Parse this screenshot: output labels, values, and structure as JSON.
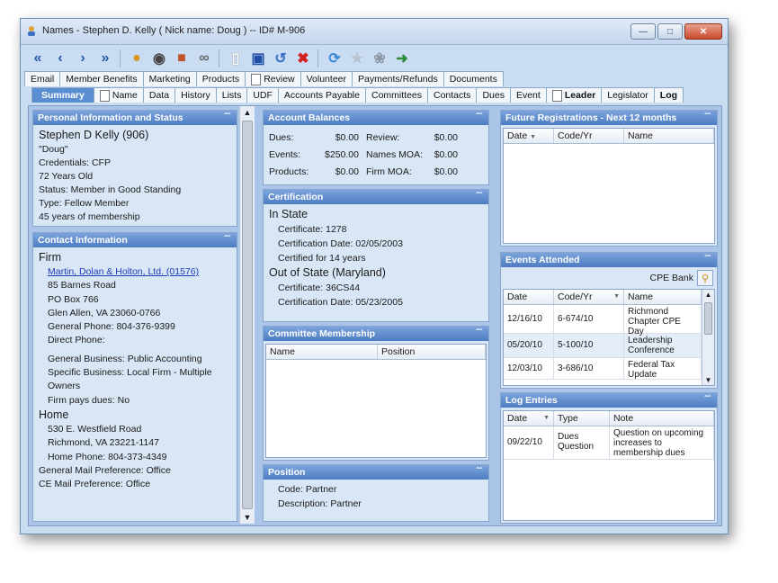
{
  "window": {
    "title": "Names - Stephen D. Kelly  ( Nick name: Doug )  -- ID# M-906"
  },
  "tabs_top": [
    "Email",
    "Member Benefits",
    "Marketing",
    "Products",
    "Review",
    "Volunteer",
    "Payments/Refunds",
    "Documents"
  ],
  "tabs_bottom": [
    "Summary",
    "Name",
    "Data",
    "History",
    "Lists",
    "UDF",
    "Accounts Payable",
    "Committees",
    "Contacts",
    "Dues",
    "Event",
    "Leader",
    "Legislator",
    "Log"
  ],
  "personal": {
    "header": "Personal Information and Status",
    "name": "Stephen D Kelly  (906)",
    "nick": "\"Doug\"",
    "credentials": "Credentials: CFP",
    "age": "72 Years Old",
    "status": "Status: Member in Good Standing",
    "type": "Type: Fellow Member",
    "years": "45 years of membership"
  },
  "contact": {
    "header": "Contact Information",
    "firm_label": "Firm",
    "firm_link": "Martin, Dolan & Holton, Ltd. (01576)",
    "addr1": "85 Barnes Road",
    "addr2": "PO Box 766",
    "city": "Glen Allen, VA 23060-0766",
    "gen_phone": "General Phone: 804-376-9399",
    "direct_phone": "Direct Phone:",
    "gen_business": "General Business: Public Accounting",
    "spec_business": "Specific Business: Local Firm - Multiple Owners",
    "firm_pays": "Firm pays dues: No",
    "home_label": "Home",
    "home_addr": "530 E. Westfield Road",
    "home_city": "Richmond, VA 23221-1147",
    "home_phone": "Home Phone: 804-373-4349",
    "gen_mail": "General Mail Preference: Office",
    "ce_mail": "CE Mail Preference: Office"
  },
  "balances": {
    "header": "Account Balances",
    "rows": [
      {
        "l1": "Dues:",
        "v1": "$0.00",
        "l2": "Review:",
        "v2": "$0.00"
      },
      {
        "l1": "Events:",
        "v1": "$250.00",
        "l2": "Names MOA:",
        "v2": "$0.00"
      },
      {
        "l1": "Products:",
        "v1": "$0.00",
        "l2": "Firm MOA:",
        "v2": "$0.00"
      }
    ]
  },
  "certification": {
    "header": "Certification",
    "in_state": "In State",
    "cert1": "Certificate: 1278",
    "cert1_date": "Certification Date: 02/05/2003",
    "cert1_for": "Certified for 14 years",
    "out_state": "Out of State (Maryland)",
    "cert2": "Certificate: 36CS44",
    "cert2_date": "Certification Date: 05/23/2005"
  },
  "committee": {
    "header": "Committee Membership",
    "col_name": "Name",
    "col_position": "Position"
  },
  "position": {
    "header": "Position",
    "code": "Code: Partner",
    "desc": "Description: Partner"
  },
  "future": {
    "header": "Future Registrations - Next 12 months",
    "col_date": "Date",
    "col_code": "Code/Yr",
    "col_name": "Name"
  },
  "events": {
    "header": "Events Attended",
    "cpe_bank": "CPE Bank",
    "col_date": "Date",
    "col_code": "Code/Yr",
    "col_name": "Name",
    "rows": [
      {
        "date": "12/16/10",
        "code": "6-674/10",
        "name": "Richmond Chapter CPE Day"
      },
      {
        "date": "05/20/10",
        "code": "5-100/10",
        "name": "Leadership Conference"
      },
      {
        "date": "12/03/10",
        "code": "3-686/10",
        "name": "Federal Tax Update"
      }
    ]
  },
  "log": {
    "header": "Log Entries",
    "col_date": "Date",
    "col_type": "Type",
    "col_note": "Note",
    "rows": [
      {
        "date": "09/22/10",
        "type": "Dues Question",
        "note": "Question on upcoming increases to membership dues"
      }
    ]
  }
}
